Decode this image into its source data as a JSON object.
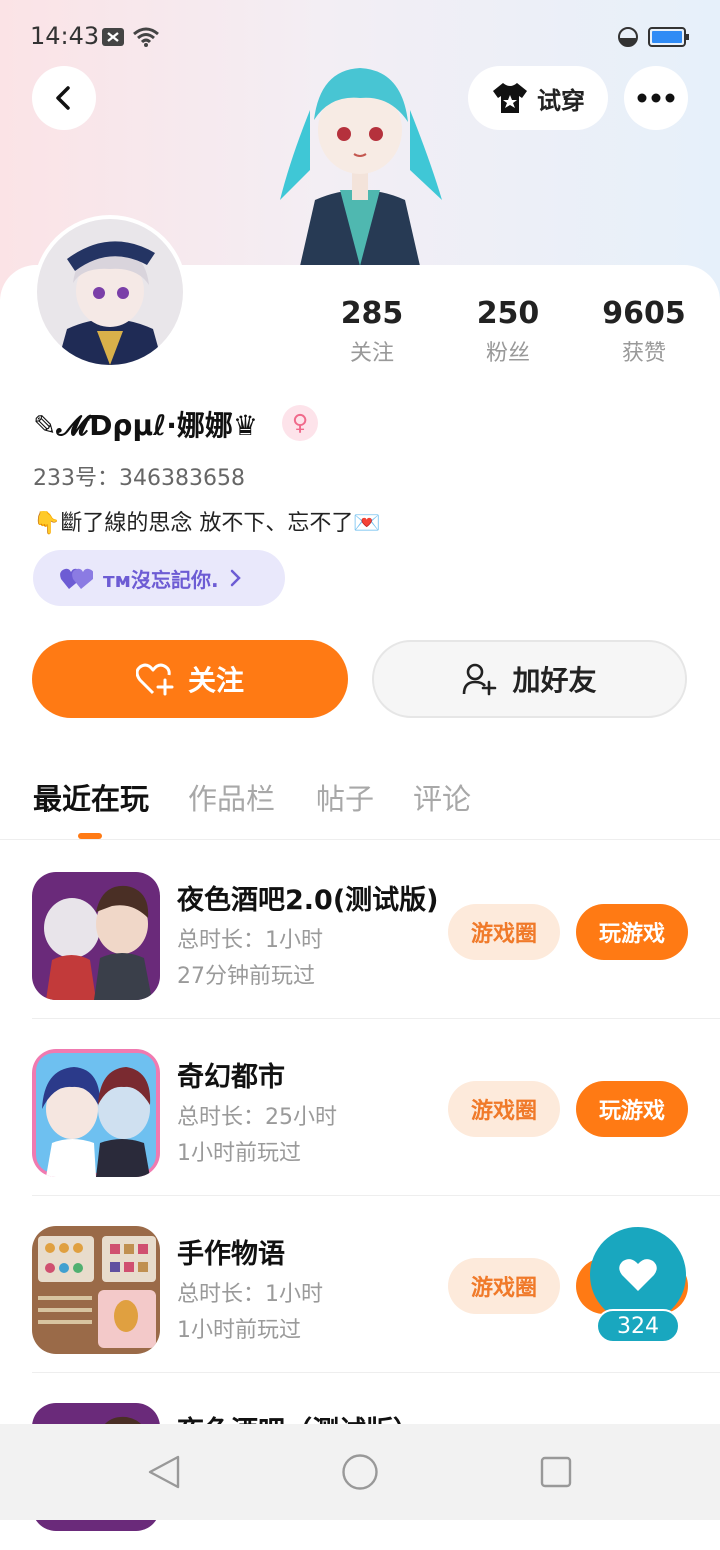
{
  "status_bar": {
    "time": "14:43"
  },
  "header": {
    "try_on_label": "试穿"
  },
  "stats": [
    {
      "value": "285",
      "label": "关注"
    },
    {
      "value": "250",
      "label": "粉丝"
    },
    {
      "value": "9605",
      "label": "获赞"
    }
  ],
  "profile": {
    "nickname": "✎𝓜Ɗρμℓ·娜娜♛",
    "gender_symbol": "♀",
    "uid": "233号：346383658",
    "bio": "👇斷了線的思念 放不下、忘不了💌",
    "group_label": "ᴛᴍ沒忘記你."
  },
  "actions": {
    "follow_label": "关注",
    "add_friend_label": "加好友"
  },
  "tabs": [
    "最近在玩",
    "作品栏",
    "帖子",
    "评论"
  ],
  "games": [
    {
      "name": "夜色酒吧2.0(测试版)",
      "duration": "总时长：1小时",
      "last_played": "27分钟前玩过",
      "circle_label": "游戏圈",
      "play_label": "玩游戏"
    },
    {
      "name": "奇幻都市",
      "duration": "总时长：25小时",
      "last_played": "1小时前玩过",
      "circle_label": "游戏圈",
      "play_label": "玩游戏"
    },
    {
      "name": "手作物语",
      "duration": "总时长：1小时",
      "last_played": "1小时前玩过",
      "circle_label": "游戏圈",
      "play_label": "玩游戏"
    },
    {
      "name": "夜色酒吧（测试版）"
    }
  ],
  "floating_like": {
    "count": "324"
  },
  "colors": {
    "accent": "#ff7a14",
    "like_teal": "#19a7bf",
    "group_purple": "#6d5cd4"
  }
}
